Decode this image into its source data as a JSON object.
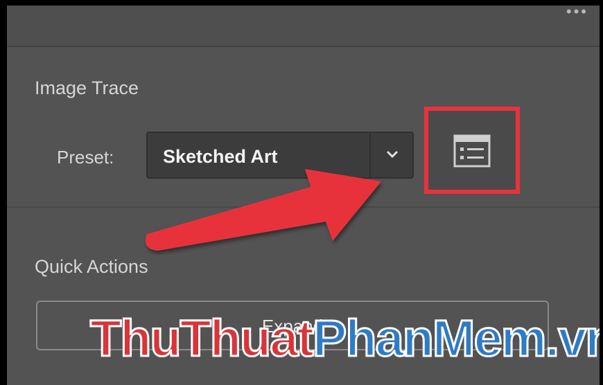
{
  "panel": {
    "more_icon": "ellipsis-icon",
    "more_glyph": "•••"
  },
  "image_trace": {
    "title": "Image Trace",
    "preset_label": "Preset:",
    "preset_value": "Sketched Art",
    "dropdown_icon": "chevron-down-icon",
    "trace_options_icon": "trace-options-panel-icon"
  },
  "quick_actions": {
    "title": "Quick Actions",
    "expand_label": "Expand"
  },
  "annotation": {
    "highlight_color": "#e8333b",
    "arrow_color": "#e8333b"
  },
  "watermark": {
    "part1": "ThuThuat",
    "part2": "PhanMem",
    "part3": ".vn",
    "color_red": "#d9343a",
    "color_blue": "#2e7bc7"
  }
}
